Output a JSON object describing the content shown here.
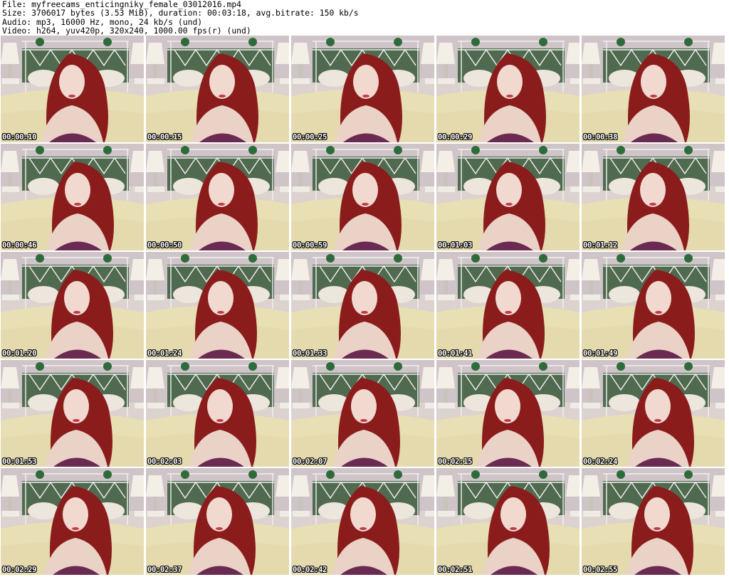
{
  "header": {
    "file_line": "File: myfreecams_enticingniky_female_03012016.mp4",
    "size_line": "Size: 3706017 bytes (3.53 MiB), duration: 00:03:18, avg.bitrate: 150 kb/s",
    "audio_line": "Audio: mp3, 16000 Hz, mono, 24 kb/s (und)",
    "video_line": "Video: h264, yuv420p, 320x240, 1000.00 fps(r) (und)"
  },
  "thumbnails": [
    {
      "timestamp": "00:00:10"
    },
    {
      "timestamp": "00:00:15"
    },
    {
      "timestamp": "00:00:25"
    },
    {
      "timestamp": "00:00:29"
    },
    {
      "timestamp": "00:00:38"
    },
    {
      "timestamp": "00:00:46"
    },
    {
      "timestamp": "00:00:50"
    },
    {
      "timestamp": "00:00:59"
    },
    {
      "timestamp": "00:01:03"
    },
    {
      "timestamp": "00:01:12"
    },
    {
      "timestamp": "00:01:20"
    },
    {
      "timestamp": "00:01:24"
    },
    {
      "timestamp": "00:01:33"
    },
    {
      "timestamp": "00:01:41"
    },
    {
      "timestamp": "00:01:49"
    },
    {
      "timestamp": "00:01:53"
    },
    {
      "timestamp": "00:02:03"
    },
    {
      "timestamp": "00:02:07"
    },
    {
      "timestamp": "00:02:15"
    },
    {
      "timestamp": "00:02:24"
    },
    {
      "timestamp": "00:02:29"
    },
    {
      "timestamp": "00:02:37"
    },
    {
      "timestamp": "00:02:42"
    },
    {
      "timestamp": "00:02:51"
    },
    {
      "timestamp": "00:02:55"
    }
  ]
}
